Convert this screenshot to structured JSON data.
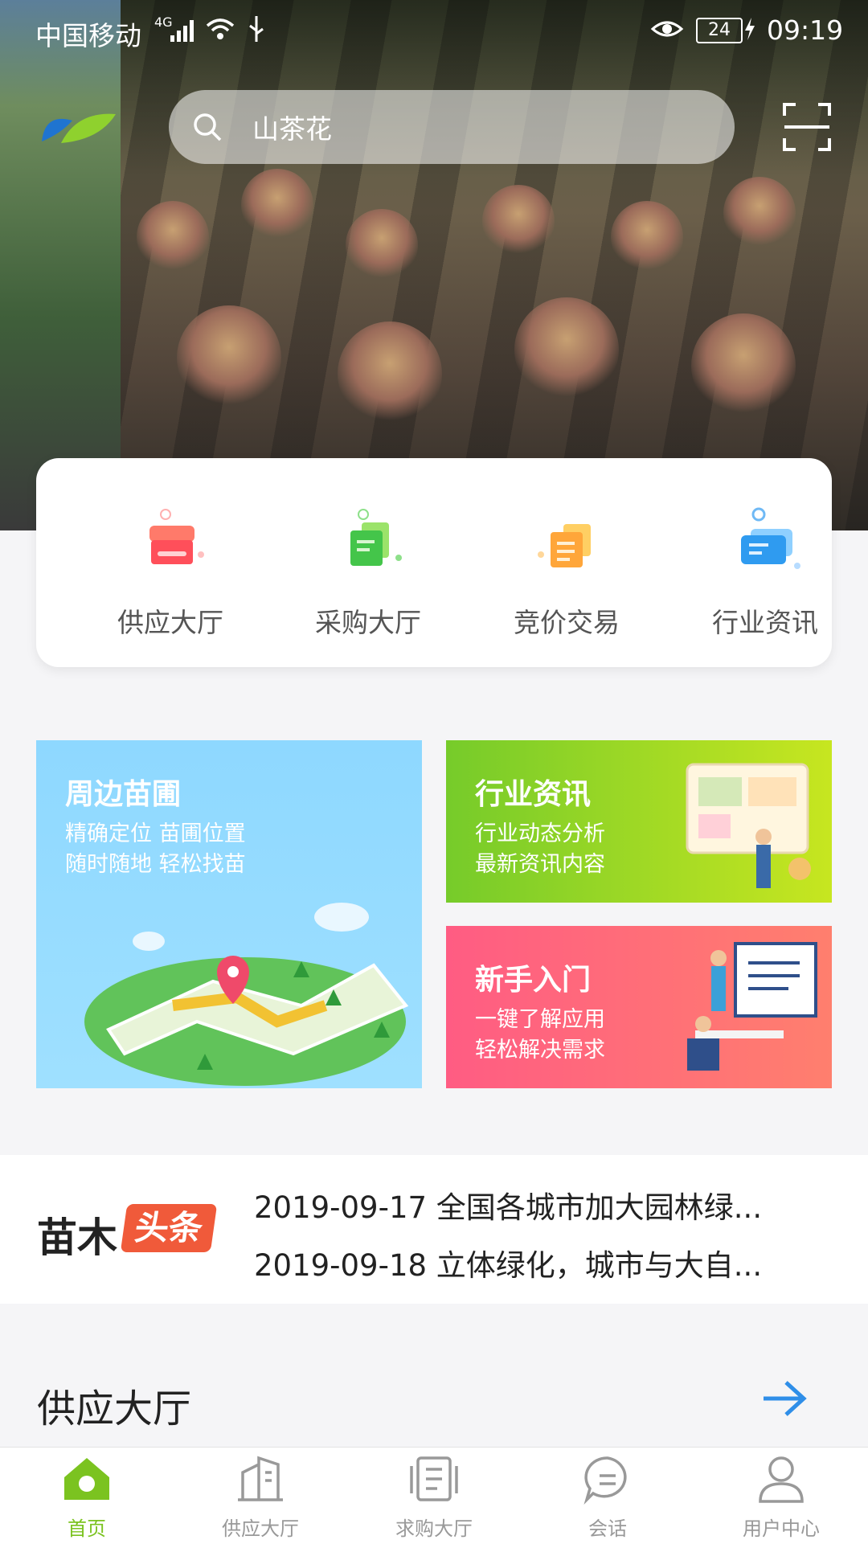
{
  "status_bar": {
    "carrier": "中国移动",
    "network": "4G",
    "battery": "24",
    "time": "09:19"
  },
  "search": {
    "value": "山茶花"
  },
  "quick_actions": [
    {
      "label": "供应大厅",
      "icon": "supply-hall-icon",
      "color": "#ff5a5a"
    },
    {
      "label": "采购大厅",
      "icon": "purchase-hall-icon",
      "color": "#4cc94a"
    },
    {
      "label": "竞价交易",
      "icon": "bidding-icon",
      "color": "#ffa63a"
    },
    {
      "label": "行业资讯",
      "icon": "industry-news-icon",
      "color": "#2f9bf0"
    }
  ],
  "promos": {
    "nearby": {
      "title": "周边苗圃",
      "line1": "精确定位 苗圃位置",
      "line2": "随时随地 轻松找苗"
    },
    "news": {
      "title": "行业资讯",
      "line1": "行业动态分析",
      "line2": "最新资讯内容"
    },
    "guide": {
      "title": "新手入门",
      "line1": "一键了解应用",
      "line2": "轻松解决需求"
    }
  },
  "headlines": {
    "logo_a": "苗木",
    "logo_b": "头条",
    "items": [
      {
        "date": "2019-09-17",
        "text": "全国各城市加大园林绿..."
      },
      {
        "date": "2019-09-18",
        "text": "立体绿化，城市与大自..."
      }
    ]
  },
  "section": {
    "title": "供应大厅"
  },
  "tabbar": [
    {
      "label": "首页",
      "active": true
    },
    {
      "label": "供应大厅",
      "active": false
    },
    {
      "label": "求购大厅",
      "active": false
    },
    {
      "label": "会话",
      "active": false
    },
    {
      "label": "用户中心",
      "active": false
    }
  ],
  "colors": {
    "accent_green": "#7bc320",
    "arrow_blue": "#2f8ee8"
  }
}
